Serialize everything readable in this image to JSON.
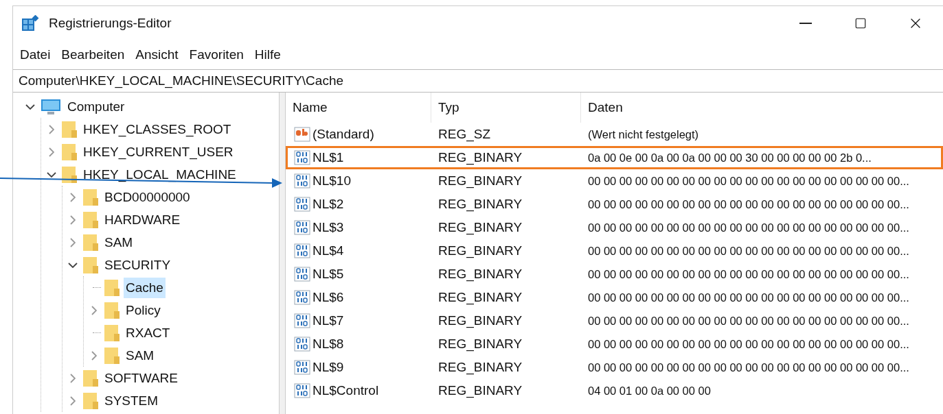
{
  "window": {
    "title": "Registrierungs-Editor"
  },
  "menu": [
    "Datei",
    "Bearbeiten",
    "Ansicht",
    "Favoriten",
    "Hilfe"
  ],
  "address": "Computer\\HKEY_LOCAL_MACHINE\\SECURITY\\Cache",
  "tree": [
    {
      "label": "Computer",
      "kind": "computer",
      "expanded": true,
      "selected": false,
      "children": [
        {
          "label": "HKEY_CLASSES_ROOT",
          "kind": "folder",
          "expanded": false,
          "selected": false
        },
        {
          "label": "HKEY_CURRENT_USER",
          "kind": "folder",
          "expanded": false,
          "selected": false
        },
        {
          "label": "HKEY_LOCAL_MACHINE",
          "kind": "folder",
          "expanded": true,
          "selected": false,
          "children": [
            {
              "label": "BCD00000000",
              "kind": "folder",
              "expanded": false,
              "selected": false
            },
            {
              "label": "HARDWARE",
              "kind": "folder",
              "expanded": false,
              "selected": false
            },
            {
              "label": "SAM",
              "kind": "folder",
              "expanded": false,
              "selected": false
            },
            {
              "label": "SECURITY",
              "kind": "folder",
              "expanded": true,
              "selected": false,
              "children": [
                {
                  "label": "Cache",
                  "kind": "leaf",
                  "selected": true
                },
                {
                  "label": "Policy",
                  "kind": "folder",
                  "expanded": false,
                  "selected": false
                },
                {
                  "label": "RXACT",
                  "kind": "leaf",
                  "selected": false
                },
                {
                  "label": "SAM",
                  "kind": "folder",
                  "expanded": false,
                  "selected": false
                }
              ]
            },
            {
              "label": "SOFTWARE",
              "kind": "folder",
              "expanded": false,
              "selected": false
            },
            {
              "label": "SYSTEM",
              "kind": "folder",
              "expanded": false,
              "selected": false
            }
          ]
        }
      ]
    }
  ],
  "table": {
    "columns": [
      "Name",
      "Typ",
      "Daten"
    ],
    "rows": [
      {
        "kind": "string",
        "name": "(Standard)",
        "type": "REG_SZ",
        "data": "(Wert nicht festgelegt)",
        "highlighted": false
      },
      {
        "kind": "binary",
        "name": "NL$1",
        "type": "REG_BINARY",
        "data": "0a 00 0e 00 0a 00 0a 00 00 00 30 00 00 00 00 00 2b 0...",
        "highlighted": true
      },
      {
        "kind": "binary",
        "name": "NL$10",
        "type": "REG_BINARY",
        "data": "00 00 00 00 00 00 00 00 00 00 00 00 00 00 00 00 00 00 00 00...",
        "highlighted": false
      },
      {
        "kind": "binary",
        "name": "NL$2",
        "type": "REG_BINARY",
        "data": "00 00 00 00 00 00 00 00 00 00 00 00 00 00 00 00 00 00 00 00...",
        "highlighted": false
      },
      {
        "kind": "binary",
        "name": "NL$3",
        "type": "REG_BINARY",
        "data": "00 00 00 00 00 00 00 00 00 00 00 00 00 00 00 00 00 00 00 00...",
        "highlighted": false
      },
      {
        "kind": "binary",
        "name": "NL$4",
        "type": "REG_BINARY",
        "data": "00 00 00 00 00 00 00 00 00 00 00 00 00 00 00 00 00 00 00 00...",
        "highlighted": false
      },
      {
        "kind": "binary",
        "name": "NL$5",
        "type": "REG_BINARY",
        "data": "00 00 00 00 00 00 00 00 00 00 00 00 00 00 00 00 00 00 00 00...",
        "highlighted": false
      },
      {
        "kind": "binary",
        "name": "NL$6",
        "type": "REG_BINARY",
        "data": "00 00 00 00 00 00 00 00 00 00 00 00 00 00 00 00 00 00 00 00...",
        "highlighted": false
      },
      {
        "kind": "binary",
        "name": "NL$7",
        "type": "REG_BINARY",
        "data": "00 00 00 00 00 00 00 00 00 00 00 00 00 00 00 00 00 00 00 00...",
        "highlighted": false
      },
      {
        "kind": "binary",
        "name": "NL$8",
        "type": "REG_BINARY",
        "data": "00 00 00 00 00 00 00 00 00 00 00 00 00 00 00 00 00 00 00 00...",
        "highlighted": false
      },
      {
        "kind": "binary",
        "name": "NL$9",
        "type": "REG_BINARY",
        "data": "00 00 00 00 00 00 00 00 00 00 00 00 00 00 00 00 00 00 00 00...",
        "highlighted": false
      },
      {
        "kind": "binary",
        "name": "NL$Control",
        "type": "REG_BINARY",
        "data": "04 00 01 00 0a 00 00 00",
        "highlighted": false
      }
    ]
  }
}
